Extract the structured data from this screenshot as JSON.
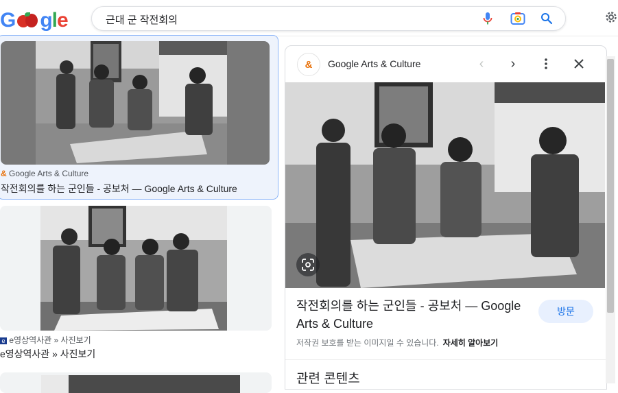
{
  "header": {
    "logo_text": "Google",
    "search_query": "근대 군 작전회의",
    "icons": [
      "mic-icon",
      "camera-lens-icon",
      "search-icon",
      "settings-gear-icon"
    ]
  },
  "results": [
    {
      "source": "Google Arts & Culture",
      "title": "작전회의를 하는 군인들 - 공보처 — Google Arts & Culture"
    },
    {
      "source": "e영상역사관 » 사진보기",
      "title": "e영상역사관 » 사진보기"
    }
  ],
  "panel": {
    "source_name": "Google Arts & Culture",
    "title": "작전회의를 하는 군인들 - 공보처 — Google Arts & Culture",
    "visit_label": "방문",
    "copyright_notice": "저작권 보호를 받는 이미지일 수 있습니다.",
    "learn_more": "자세히 알아보기",
    "related_heading": "관련 콘텐츠"
  },
  "colors": {
    "accent_blue": "#1a73e8",
    "selected_border": "#8ab4f8",
    "selected_bg": "#eef3fc"
  }
}
